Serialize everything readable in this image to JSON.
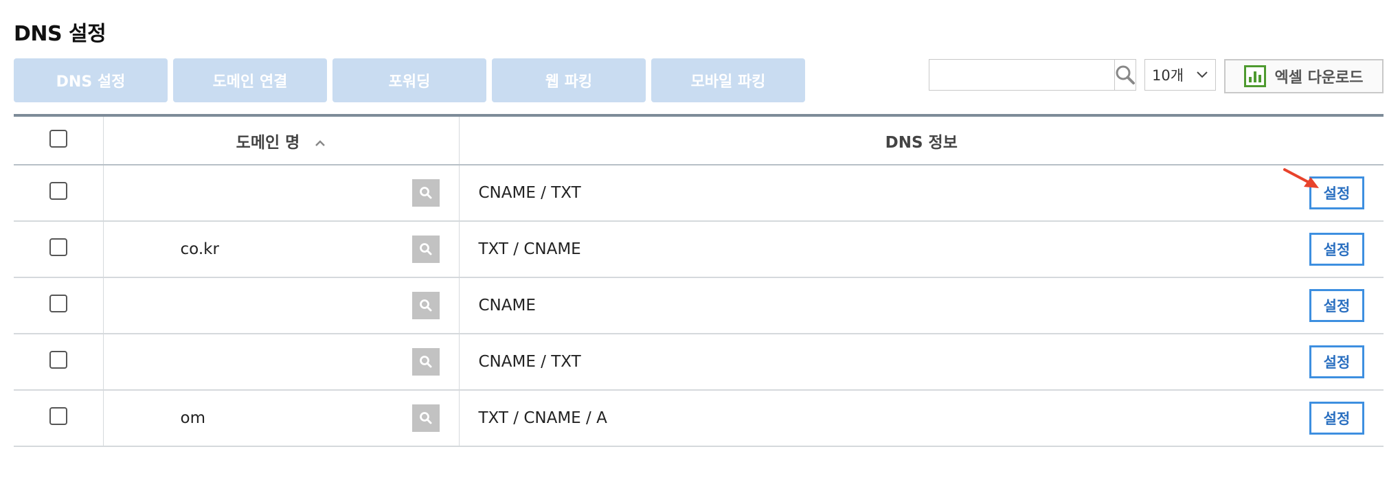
{
  "page": {
    "title": "DNS 설정"
  },
  "toolbar": {
    "tabs": [
      {
        "label": "DNS 설정"
      },
      {
        "label": "도메인 연결"
      },
      {
        "label": "포워딩"
      },
      {
        "label": "웹 파킹"
      },
      {
        "label": "모바일 파킹"
      }
    ],
    "search": {
      "value": "",
      "placeholder": ""
    },
    "page_size": "10개",
    "excel_label": "엑셀 다운로드"
  },
  "table": {
    "headers": {
      "domain": "도메인 명",
      "dns": "DNS 정보"
    },
    "rows": [
      {
        "domain": "",
        "dns": "CNAME / TXT",
        "action": "설정"
      },
      {
        "domain": "co.kr",
        "dns": "TXT / CNAME",
        "action": "설정"
      },
      {
        "domain": "",
        "dns": "CNAME",
        "action": "설정"
      },
      {
        "domain": "",
        "dns": "CNAME / TXT",
        "action": "설정"
      },
      {
        "domain": "om",
        "dns": "TXT / CNAME / A",
        "action": "설정"
      }
    ]
  },
  "colors": {
    "accent": "#3d8fe0",
    "tab_bg": "#c9dcf1",
    "excel_green": "#4e9a2f",
    "annotation_arrow": "#e8432c"
  },
  "icons": {
    "search": "search-icon",
    "sort": "chevron-up-icon",
    "dropdown": "chevron-down-icon",
    "excel": "excel-chart-icon"
  }
}
